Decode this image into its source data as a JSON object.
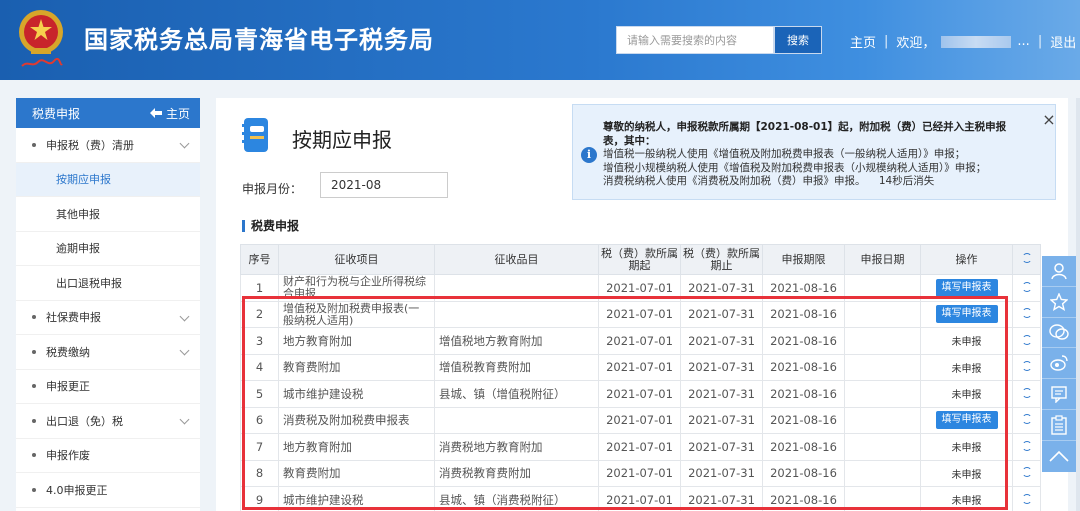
{
  "header": {
    "title": "国家税务总局青海省电子税务局",
    "search": {
      "placeholder": "请输入需要搜索的内容",
      "button": "搜索"
    },
    "nav": {
      "home": "主页",
      "welcome": "欢迎，",
      "ellipsis": "...",
      "logout": "退出",
      "sep": "|"
    }
  },
  "sidebar": {
    "title": "税费申报",
    "home_link": "主页",
    "items": [
      {
        "label": "申报税（费）清册",
        "level": 1,
        "chevron": true
      },
      {
        "label": "按期应申报",
        "level": 2,
        "active": true
      },
      {
        "label": "其他申报",
        "level": 2
      },
      {
        "label": "逾期申报",
        "level": 2
      },
      {
        "label": "出口退税申报",
        "level": 2
      },
      {
        "label": "社保费申报",
        "level": 1,
        "chevron": true
      },
      {
        "label": "税费缴纳",
        "level": 1,
        "chevron": true
      },
      {
        "label": "申报更正",
        "level": 1
      },
      {
        "label": "出口退（免）税",
        "level": 1,
        "chevron": true
      },
      {
        "label": "申报作废",
        "level": 1
      },
      {
        "label": "4.0申报更正",
        "level": 1
      }
    ]
  },
  "main": {
    "title": "按期应申报",
    "period_label": "申报月份：",
    "period_value": "2021-08",
    "section_title": "税费申报",
    "notice": {
      "line1": "尊敬的纳税人，申报税款所属期【2021-08-01】起，附加税（费）已经并入主税申报",
      "line2": "表，其中：",
      "line3": "增值税一般纳税人使用《增值税及附加税费申报表（一般纳税人适用）》申报；",
      "line4": "增值税小规模纳税人使用《增值税及附加税费申报表（小规模纳税人适用）》申报；",
      "line5": "消费税纳税人使用《消费税及附加税（费）申报》申报。",
      "countdown": "14秒后消失",
      "close": "×"
    },
    "table": {
      "headers": [
        "序号",
        "征收项目",
        "征收品目",
        "税（费）款所属期起",
        "税（费）款所属期止",
        "申报期限",
        "申报日期",
        "操作"
      ],
      "rows": [
        {
          "no": "1",
          "item": "财产和行为税与企业所得税综合申报",
          "sub": "",
          "start": "2021-07-01",
          "end": "2021-07-31",
          "deadline": "2021-08-16",
          "date": "",
          "action": "填写申报表",
          "action_type": "button"
        },
        {
          "no": "2",
          "item": "增值税及附加税费申报表(一般纳税人适用)",
          "sub": "",
          "start": "2021-07-01",
          "end": "2021-07-31",
          "deadline": "2021-08-16",
          "date": "",
          "action": "填写申报表",
          "action_type": "button"
        },
        {
          "no": "3",
          "item": "地方教育附加",
          "sub": "增值税地方教育附加",
          "start": "2021-07-01",
          "end": "2021-07-31",
          "deadline": "2021-08-16",
          "date": "",
          "action": "未申报",
          "action_type": "text"
        },
        {
          "no": "4",
          "item": "教育费附加",
          "sub": "增值税教育费附加",
          "start": "2021-07-01",
          "end": "2021-07-31",
          "deadline": "2021-08-16",
          "date": "",
          "action": "未申报",
          "action_type": "text"
        },
        {
          "no": "5",
          "item": "城市维护建设税",
          "sub": "县城、镇（增值税附征）",
          "start": "2021-07-01",
          "end": "2021-07-31",
          "deadline": "2021-08-16",
          "date": "",
          "action": "未申报",
          "action_type": "text"
        },
        {
          "no": "6",
          "item": "消费税及附加税费申报表",
          "sub": "",
          "start": "2021-07-01",
          "end": "2021-07-31",
          "deadline": "2021-08-16",
          "date": "",
          "action": "填写申报表",
          "action_type": "button"
        },
        {
          "no": "7",
          "item": "地方教育附加",
          "sub": "消费税地方教育附加",
          "start": "2021-07-01",
          "end": "2021-07-31",
          "deadline": "2021-08-16",
          "date": "",
          "action": "未申报",
          "action_type": "text"
        },
        {
          "no": "8",
          "item": "教育费附加",
          "sub": "消费税教育费附加",
          "start": "2021-07-01",
          "end": "2021-07-31",
          "deadline": "2021-08-16",
          "date": "",
          "action": "未申报",
          "action_type": "text"
        },
        {
          "no": "9",
          "item": "城市维护建设税",
          "sub": "县城、镇（消费税附征）",
          "start": "2021-07-01",
          "end": "2021-07-31",
          "deadline": "2021-08-16",
          "date": "",
          "action": "未申报",
          "action_type": "text"
        }
      ]
    }
  },
  "float_toolbar": [
    "user-icon",
    "star-icon",
    "chat-icon",
    "weibo-icon",
    "message-icon",
    "clipboard-icon",
    "up-arrow-icon"
  ],
  "colors": {
    "header": "#2b79cf",
    "accent": "#2c77cc",
    "highlight": "#e8323a",
    "button": "#2c86e0"
  }
}
